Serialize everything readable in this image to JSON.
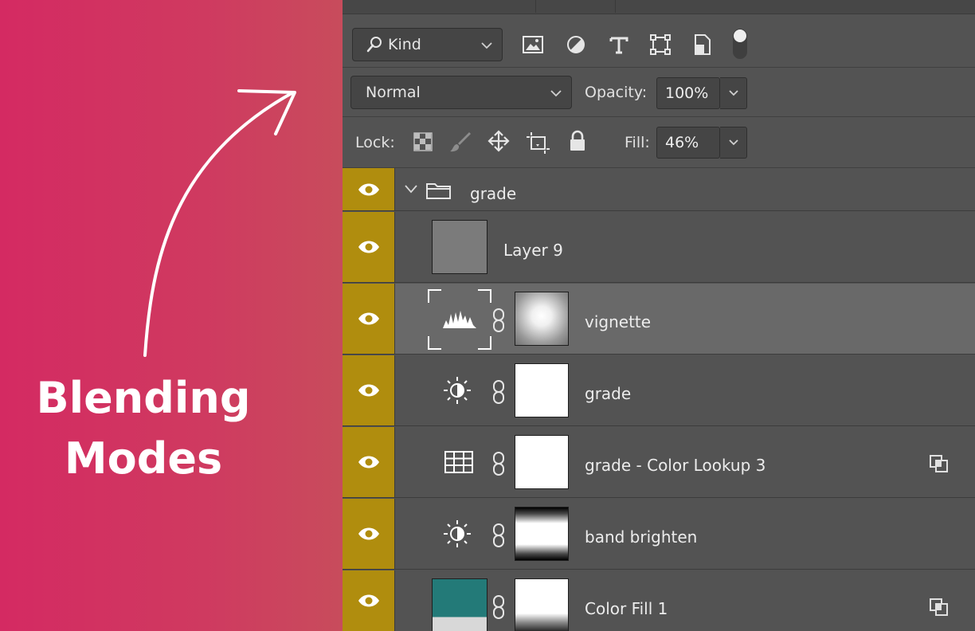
{
  "promo": {
    "title_line1": "Blending",
    "title_line2": "Modes"
  },
  "filter": {
    "kind_label": "Kind",
    "icons": [
      "image-filter-icon",
      "adjustment-filter-icon",
      "type-filter-icon",
      "shape-filter-icon",
      "smart-object-filter-icon",
      "filter-toggle-icon"
    ]
  },
  "blend": {
    "mode": "Normal",
    "opacity_label": "Opacity:",
    "opacity_value": "100%"
  },
  "lock": {
    "label": "Lock:",
    "icons": [
      "lock-transparent-pixels-icon",
      "lock-image-pixels-icon",
      "lock-position-icon",
      "lock-artboard-icon",
      "lock-all-icon"
    ],
    "fill_label": "Fill:",
    "fill_value": "46%"
  },
  "layers": [
    {
      "name": "grade",
      "type": "group"
    },
    {
      "name": "Layer 9",
      "type": "pixel"
    },
    {
      "name": "vignette",
      "type": "levels",
      "selected": true
    },
    {
      "name": "grade",
      "type": "brightness"
    },
    {
      "name": "grade - Color Lookup 3",
      "type": "lookup",
      "badge": true
    },
    {
      "name": "band brighten",
      "type": "brightness"
    },
    {
      "name": "Color Fill 1",
      "type": "fill",
      "badge": true
    }
  ],
  "colors": {
    "promo_start": "#d42a62",
    "promo_end": "#c84c5c",
    "visibility_column": "#b08d0e",
    "panel_bg": "#535353",
    "selected_row": "#696969",
    "fill_swatch": "#237a78"
  }
}
